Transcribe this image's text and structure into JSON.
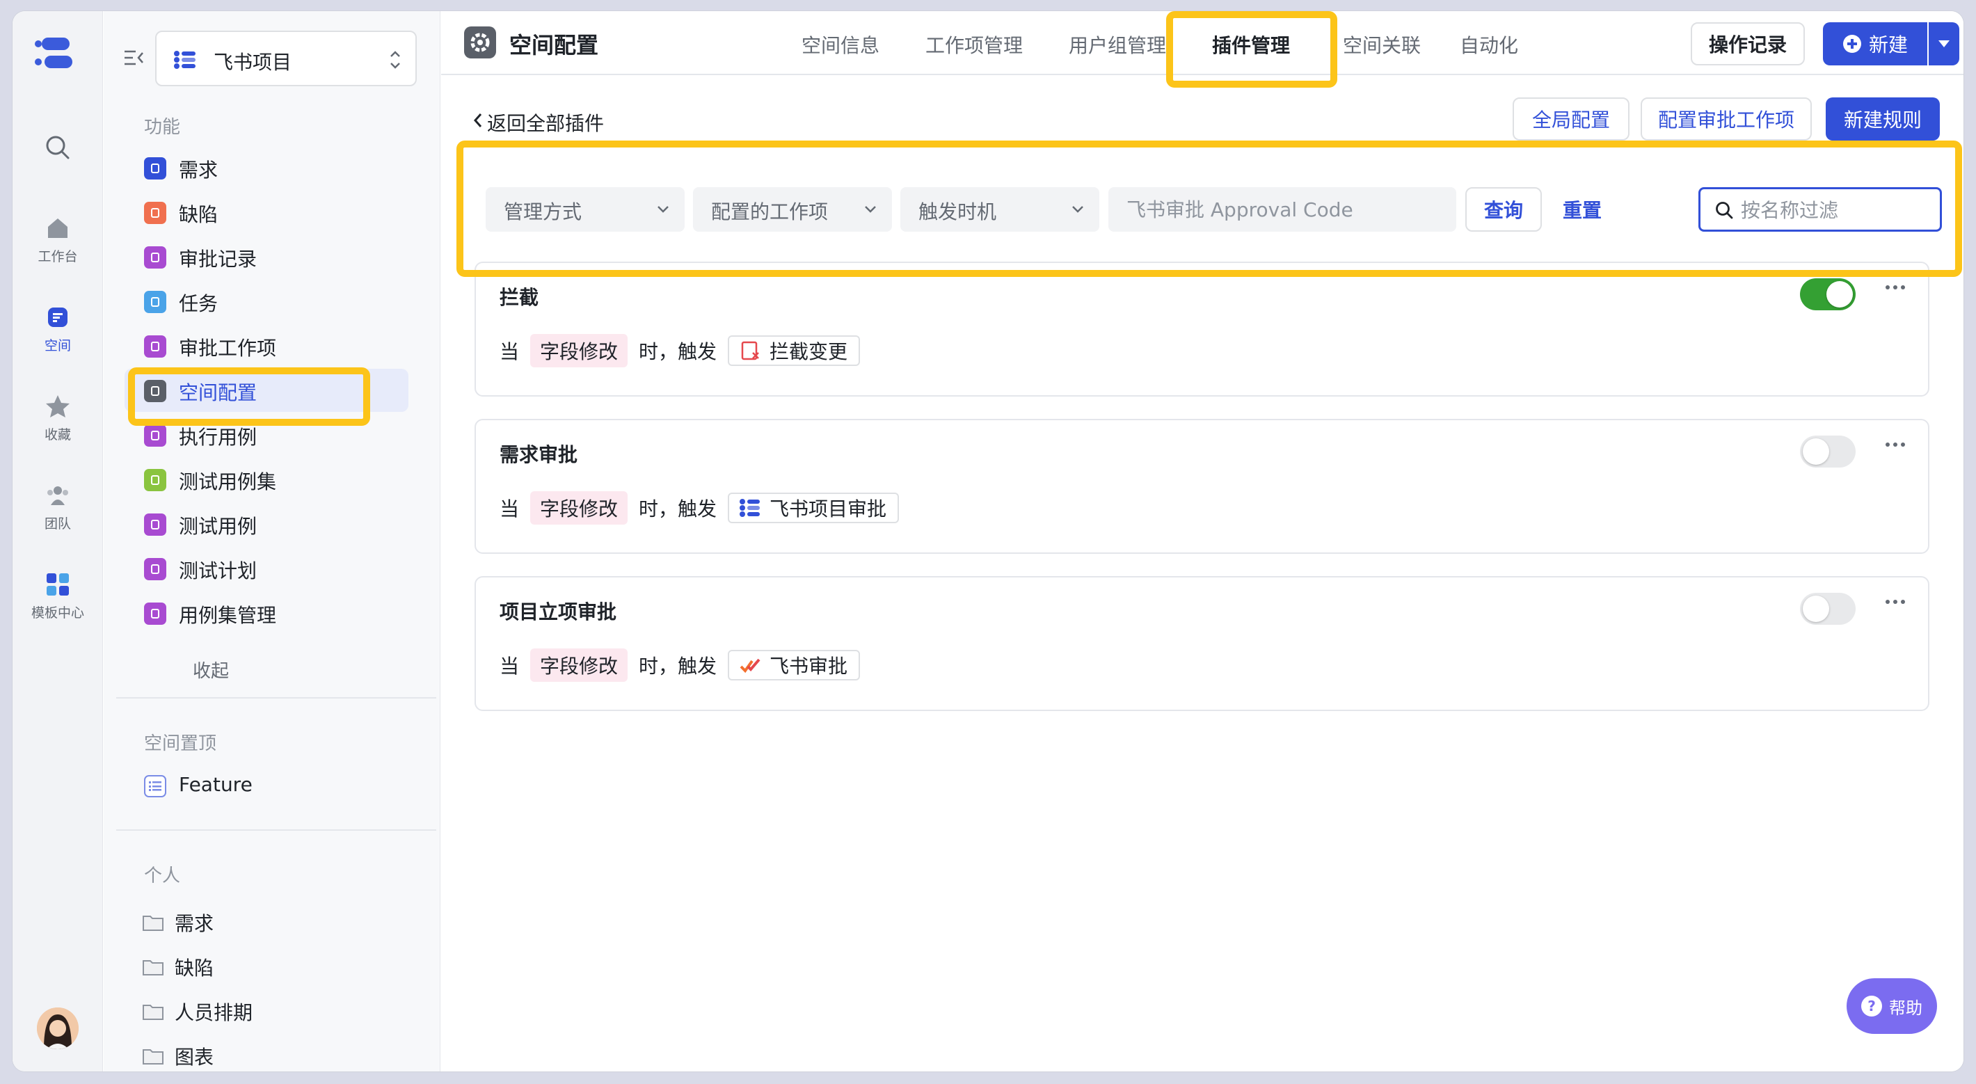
{
  "rail": {
    "items": [
      {
        "label": "工作台"
      },
      {
        "label": "空间"
      },
      {
        "label": "收藏"
      },
      {
        "label": "团队"
      },
      {
        "label": "模板中心"
      }
    ]
  },
  "sidebar": {
    "project_name": "飞书项目",
    "section_features": "功能",
    "features": [
      {
        "label": "需求",
        "color": "#3250d8"
      },
      {
        "label": "缺陷",
        "color": "#f0704f"
      },
      {
        "label": "审批记录",
        "color": "#a84bd1"
      },
      {
        "label": "任务",
        "color": "#4aa3e8"
      },
      {
        "label": "审批工作项",
        "color": "#a84bd1"
      },
      {
        "label": "空间配置",
        "color": "#5a5f68"
      },
      {
        "label": "执行用例",
        "color": "#a84bd1"
      },
      {
        "label": "测试用例集",
        "color": "#8ac43f"
      },
      {
        "label": "测试用例",
        "color": "#a84bd1"
      },
      {
        "label": "测试计划",
        "color": "#a84bd1"
      },
      {
        "label": "用例集管理",
        "color": "#a84bd1"
      }
    ],
    "collapse_label": "收起",
    "section_pinned": "空间置顶",
    "pinned": [
      {
        "label": "Feature"
      }
    ],
    "section_personal": "个人",
    "personal": [
      {
        "label": "需求"
      },
      {
        "label": "缺陷"
      },
      {
        "label": "人员排期"
      },
      {
        "label": "图表"
      }
    ]
  },
  "header": {
    "title": "空间配置",
    "tabs": [
      {
        "label": "空间信息"
      },
      {
        "label": "工作项管理"
      },
      {
        "label": "用户组管理"
      },
      {
        "label": "插件管理"
      },
      {
        "label": "空间关联"
      },
      {
        "label": "自动化"
      }
    ],
    "history_label": "操作记录",
    "new_label": "新建"
  },
  "toolbar": {
    "back_label": "返回全部插件",
    "global_config": "全局配置",
    "config_approval": "配置审批工作项",
    "new_rule": "新建规则"
  },
  "filters": {
    "mode": "管理方式",
    "work_item": "配置的工作项",
    "trigger": "触发时机",
    "approval_code_placeholder": "飞书审批 Approval Code",
    "query": "查询",
    "reset": "重置",
    "search_placeholder": "按名称过滤"
  },
  "rules": [
    {
      "title": "拦截",
      "when": "当",
      "field": "字段修改",
      "then": "时，触发",
      "action": "拦截变更",
      "enabled": true
    },
    {
      "title": "需求审批",
      "when": "当",
      "field": "字段修改",
      "then": "时，触发",
      "action": "飞书项目审批",
      "enabled": false
    },
    {
      "title": "项目立项审批",
      "when": "当",
      "field": "字段修改",
      "then": "时，触发",
      "action": "飞书审批",
      "enabled": false
    }
  ],
  "help_label": "帮助",
  "colors": {
    "accent": "#3250d8",
    "highlight": "#fcc419",
    "toggle_on": "#34a033"
  }
}
